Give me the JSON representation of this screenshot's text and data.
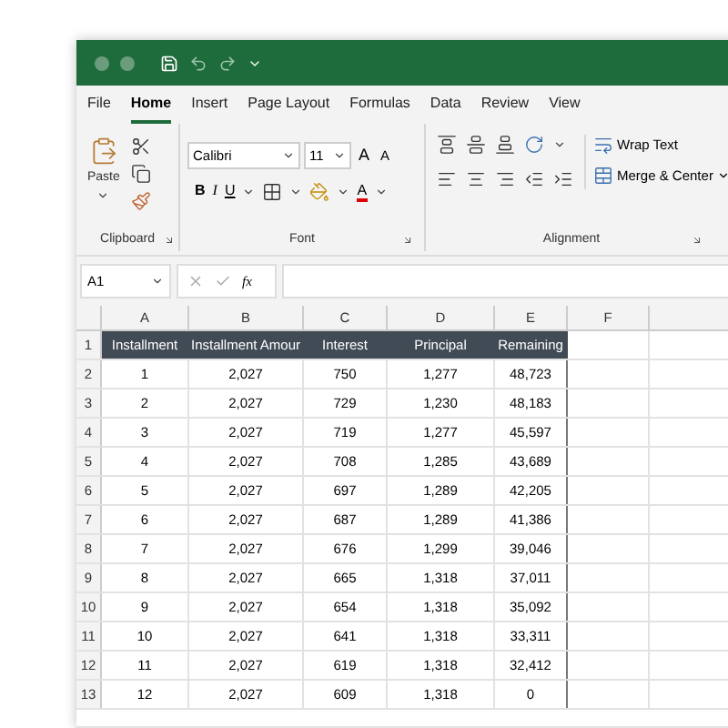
{
  "tabs": [
    {
      "label": "File",
      "selected": false
    },
    {
      "label": "Home",
      "selected": true
    },
    {
      "label": "Insert",
      "selected": false
    },
    {
      "label": "Page Layout",
      "selected": false
    },
    {
      "label": "Formulas",
      "selected": false
    },
    {
      "label": "Data",
      "selected": false
    },
    {
      "label": "Review",
      "selected": false
    },
    {
      "label": "View",
      "selected": false
    }
  ],
  "ribbon": {
    "clipboard": {
      "paste": "Paste",
      "label": "Clipboard"
    },
    "font": {
      "name": "Calibri",
      "size": "11",
      "grow": "A",
      "shrink": "A",
      "bold": "B",
      "italic": "I",
      "underline": "U",
      "font_color_letter": "A",
      "label": "Font"
    },
    "alignment": {
      "wrap": "Wrap Text",
      "merge": "Merge & Center",
      "label": "Alignment"
    }
  },
  "formula_bar": {
    "name_box": "A1",
    "fx": "fx"
  },
  "sheet": {
    "columns": [
      "A",
      "B",
      "C",
      "D",
      "E",
      "F"
    ],
    "header_row": {
      "number": "1",
      "cells": [
        "Installment",
        "Installment Amour",
        "Interest",
        "Principal",
        "Remaining"
      ]
    },
    "rows": [
      {
        "number": "2",
        "cells": [
          "1",
          "2,027",
          "750",
          "1,277",
          "48,723"
        ]
      },
      {
        "number": "3",
        "cells": [
          "2",
          "2,027",
          "729",
          "1,230",
          "48,183"
        ]
      },
      {
        "number": "4",
        "cells": [
          "3",
          "2,027",
          "719",
          "1,277",
          "45,597"
        ]
      },
      {
        "number": "5",
        "cells": [
          "4",
          "2,027",
          "708",
          "1,285",
          "43,689"
        ]
      },
      {
        "number": "6",
        "cells": [
          "5",
          "2,027",
          "697",
          "1,289",
          "42,205"
        ]
      },
      {
        "number": "7",
        "cells": [
          "6",
          "2,027",
          "687",
          "1,289",
          "41,386"
        ]
      },
      {
        "number": "8",
        "cells": [
          "7",
          "2,027",
          "676",
          "1,299",
          "39,046"
        ]
      },
      {
        "number": "9",
        "cells": [
          "8",
          "2,027",
          "665",
          "1,318",
          "37,011"
        ]
      },
      {
        "number": "10",
        "cells": [
          "9",
          "2,027",
          "654",
          "1,318",
          "35,092"
        ]
      },
      {
        "number": "11",
        "cells": [
          "10",
          "2,027",
          "641",
          "1,318",
          "33,311"
        ]
      },
      {
        "number": "12",
        "cells": [
          "11",
          "2,027",
          "619",
          "1,318",
          "32,412"
        ]
      },
      {
        "number": "13",
        "cells": [
          "12",
          "2,027",
          "609",
          "1,318",
          "0"
        ]
      }
    ]
  }
}
